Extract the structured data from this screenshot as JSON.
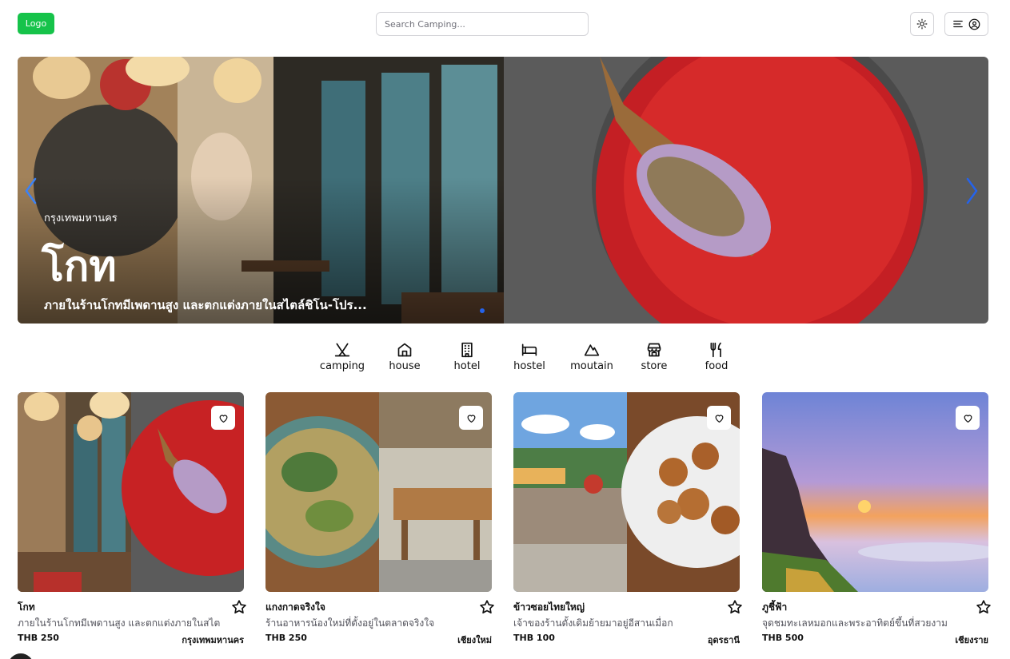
{
  "header": {
    "logo": "Logo",
    "search_placeholder": "Search Camping..."
  },
  "hero": {
    "location": "กรุงเทพมหานคร",
    "title": "โกท",
    "description": "ภายในร้านโกทมีเพดานสูง และตกแต่งภายในสไตล์ชิโน-โปร..."
  },
  "categories": [
    {
      "label": "camping",
      "icon": "tent-icon"
    },
    {
      "label": "house",
      "icon": "house-icon"
    },
    {
      "label": "hotel",
      "icon": "hotel-icon"
    },
    {
      "label": "hostel",
      "icon": "bed-icon"
    },
    {
      "label": "moutain",
      "icon": "mountain-icon"
    },
    {
      "label": "store",
      "icon": "store-icon"
    },
    {
      "label": "food",
      "icon": "utensils-icon"
    }
  ],
  "cards": [
    {
      "name": "โกท",
      "description": "ภายในร้านโกทมีเพดานสูง และตกแต่งภายในสไต",
      "price": "THB 250",
      "province": "กรุงเทพมหานคร"
    },
    {
      "name": "แกงกาดจริงใจ",
      "description": "ร้านอาหารน้องใหม่ที่ตั้งอยู่ในตลาดจริงใจ",
      "price": "THB 250",
      "province": "เชียงใหม่"
    },
    {
      "name": "ข้าวซอยไทยใหญ่",
      "description": "เจ้าของร้านดั้งเดิมย้ายมาอยู่อีสานเมื่อก",
      "price": "THB 100",
      "province": "อุดรธานี"
    },
    {
      "name": "ภูชี้ฟ้า",
      "description": "จุดชมทะเลหมอกและพระอาทิตย์ขึ้นที่สวยงาม",
      "price": "THB 500",
      "province": "เชียงราย"
    }
  ],
  "colors": {
    "brand": "#16c34a",
    "accent": "#2563eb"
  }
}
